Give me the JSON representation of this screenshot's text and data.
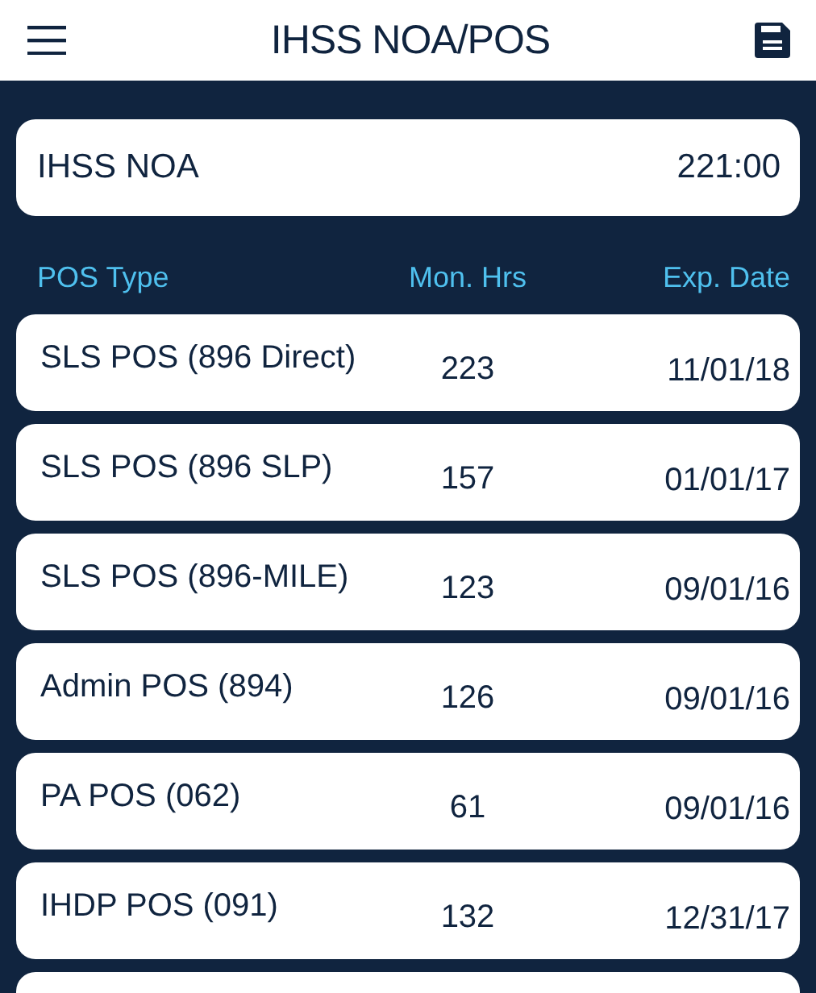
{
  "header": {
    "title": "IHSS NOA/POS"
  },
  "noa": {
    "label": "IHSS NOA",
    "value": "221:00"
  },
  "columns": [
    "POS Type",
    "Mon. Hrs",
    "Exp. Date"
  ],
  "rows": [
    {
      "kind": "entry",
      "type": "SLS POS (896 Direct)",
      "hours": "223",
      "expires": "11/01/18"
    },
    {
      "kind": "entry",
      "type": "SLS POS (896 SLP)",
      "hours": "157",
      "expires": "01/01/17"
    },
    {
      "kind": "entry",
      "type": "SLS POS (896-MILE)",
      "hours": "123",
      "expires": "09/01/16"
    },
    {
      "kind": "entry",
      "type": "Admin POS (894)",
      "hours": "126",
      "expires": "09/01/16"
    },
    {
      "kind": "entry",
      "type": "PA POS (062)",
      "hours": "61",
      "expires": "09/01/16"
    },
    {
      "kind": "entry",
      "type": "IHDP POS (091)",
      "hours": "132",
      "expires": "12/31/17"
    },
    {
      "kind": "partial"
    }
  ]
}
